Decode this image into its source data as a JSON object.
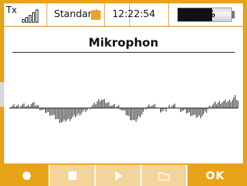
{
  "statusbar": {
    "tx_label": "Tx",
    "model_name": "Standard",
    "clock": "12:22:54",
    "battery_percent": "64%",
    "battery_level": 0.64,
    "signal_bars": 5
  },
  "screen": {
    "title": "Mikrophon"
  },
  "buttons": [
    {
      "name": "record",
      "icon": "record-circle",
      "enabled": true
    },
    {
      "name": "stop",
      "icon": "stop-square",
      "enabled": false
    },
    {
      "name": "play",
      "icon": "play-triangle",
      "enabled": false
    },
    {
      "name": "open",
      "icon": "folder",
      "enabled": false
    },
    {
      "name": "ok",
      "label": "OK",
      "enabled": true
    }
  ],
  "waveform": {
    "samples": [
      0.3,
      0.4,
      0.6,
      0.5,
      0.8,
      0.6,
      0.5,
      1.2,
      1.0,
      0.6,
      -0.4,
      -0.8,
      -1.1,
      -1.5,
      -2.0,
      -2.6,
      -3.2,
      -3.5,
      -3.0,
      -2.8,
      -2.4,
      -2.0,
      -1.6,
      -1.2,
      -0.8,
      -0.4,
      0.4,
      0.8,
      1.6,
      2.2,
      1.9,
      1.4,
      1.0,
      0.6,
      0.5,
      0.4,
      -0.6,
      -1.2,
      -2.2,
      -2.8,
      -3.4,
      -2.6,
      -1.6,
      -0.8,
      0.4,
      0.8,
      0.6,
      0.4,
      -0.6,
      -0.8,
      -0.6,
      0.5,
      0.7,
      0.6,
      -0.4,
      -0.6,
      -0.8,
      -1.2,
      -1.6,
      -2.0,
      -2.2,
      -2.0,
      -1.6,
      -0.8,
      0.6,
      0.9,
      1.2,
      1.4,
      1.6,
      1.6,
      1.7,
      2.0,
      2.8,
      1.8
    ],
    "colors": {
      "line": "#111111"
    }
  },
  "colors": {
    "frame": "#e8a419",
    "status_square": "#f0a020",
    "button_dim": "#f3d49a"
  }
}
